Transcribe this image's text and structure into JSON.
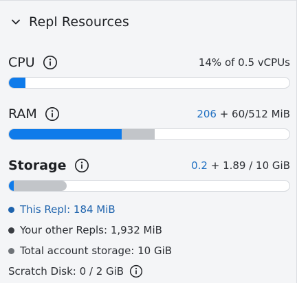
{
  "section": {
    "title": "Repl Resources"
  },
  "cpu": {
    "label": "CPU",
    "usage": "14% of 0.5 vCPUs",
    "used_fraction": 0.06
  },
  "ram": {
    "label": "RAM",
    "usage_highlight": "206",
    "usage_rest": " + 60/512 MiB",
    "used_fraction": 0.4023,
    "other_fraction": 0.1172
  },
  "storage": {
    "label": "Storage",
    "usage_highlight": "0.2",
    "usage_rest": " + 1.89 / 10 GiB",
    "used_fraction": 0.018,
    "other_fraction": 0.189
  },
  "legend": {
    "this_repl": "This Repl: 184 MiB",
    "other_repls": "Your other Repls: 1,932 MiB",
    "total_storage": "Total account storage: 10 GiB"
  },
  "scratch": {
    "label": "Scratch Disk: 0 / 2 GiB"
  },
  "colors": {
    "blue": "#0f7bea",
    "gray": "#c2c5c9",
    "this_text": "#1e63ad",
    "highlight": "#1e6fc2"
  },
  "icons": {
    "collapse": "chevron-down-icon",
    "info": "info-icon"
  }
}
